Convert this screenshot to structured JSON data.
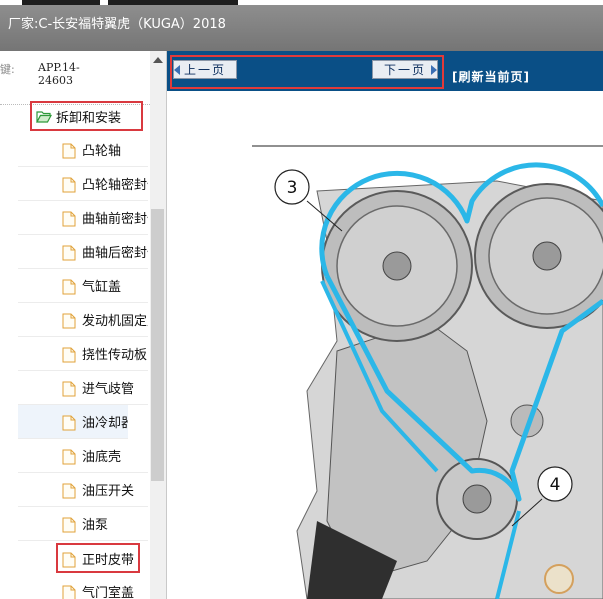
{
  "window": {
    "title": "厂家:C-长安福特翼虎（KUGA）2018"
  },
  "sidebar": {
    "header_left": "键:",
    "header_code": [
      "APP.14-",
      "24603"
    ],
    "folder_label": "拆卸和安装",
    "items": [
      {
        "label": "凸轮轴"
      },
      {
        "label": "凸轮轴密封件"
      },
      {
        "label": "曲轴前密封件"
      },
      {
        "label": "曲轴后密封件"
      },
      {
        "label": "气缸盖"
      },
      {
        "label": "发动机固定支架"
      },
      {
        "label": "挠性传动板"
      },
      {
        "label": "进气歧管"
      },
      {
        "label": "油冷却器"
      },
      {
        "label": "油底壳"
      },
      {
        "label": "油压开关"
      },
      {
        "label": "油泵"
      },
      {
        "label": "正时皮带"
      },
      {
        "label": "气门室盖"
      }
    ]
  },
  "toolbar": {
    "prev_label": "上一页",
    "next_label": "下一页",
    "refresh_label": "[刷新当前页]"
  },
  "diagram": {
    "callouts": [
      "3",
      "4"
    ]
  },
  "colors": {
    "titlebar": "#7f7f7f",
    "navbar": "#0a4f86",
    "highlight_box": "#d9393f",
    "belt": "#2bb7e8"
  }
}
